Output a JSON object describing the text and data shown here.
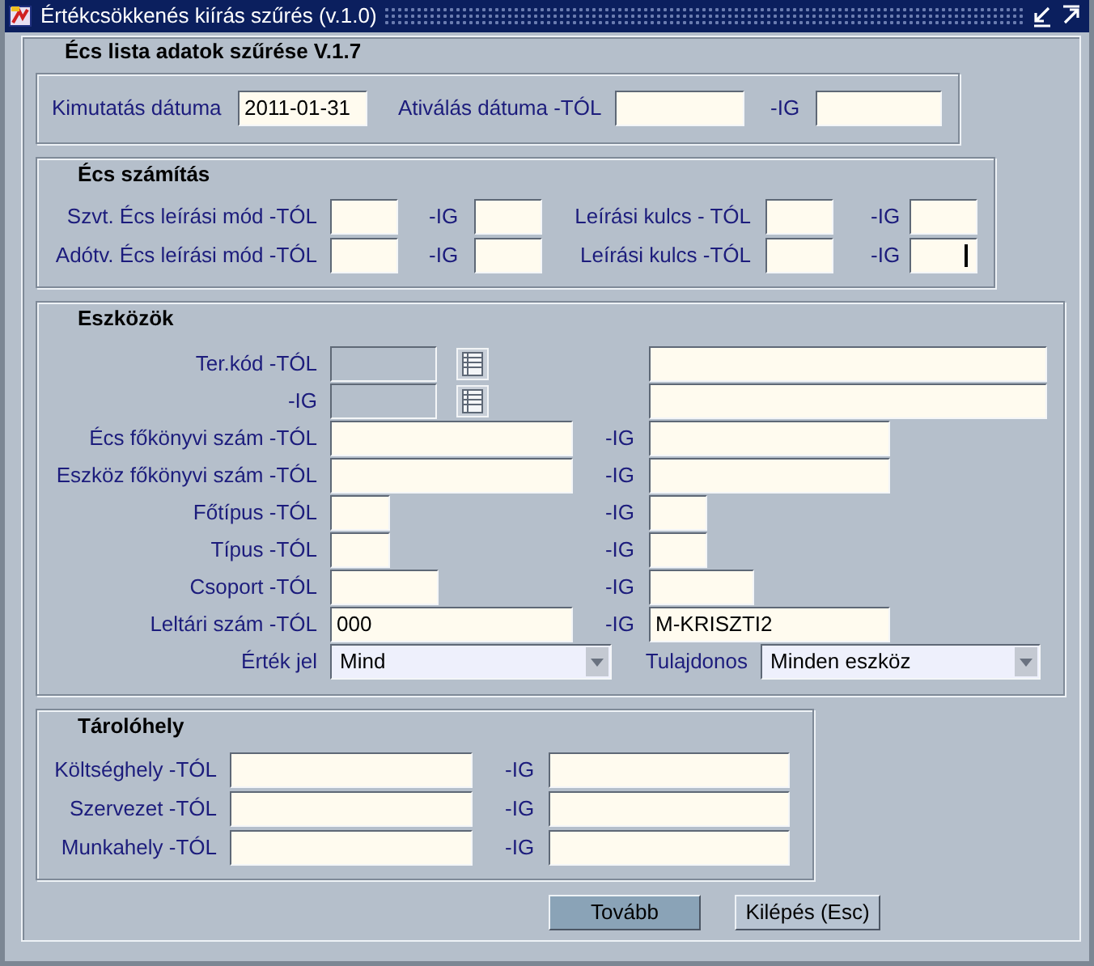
{
  "window": {
    "title": "Értékcsökkenés kiírás szűrés (v.1.0)"
  },
  "form_title": "Écs lista adatok szűrése V.1.7",
  "report": {
    "date_label": "Kimutatás dátuma",
    "date_value": "2011-01-31",
    "activation_from_label": "Ativálás dátuma -TÓL",
    "activation_to_label": "-IG"
  },
  "calculation": {
    "title": "Écs számítás",
    "rows": [
      {
        "label": "Szvt. Écs leírási mód -TÓL",
        "to_label": "-IG",
        "key_label": "Leírási kulcs - TÓL",
        "key_to_label": "-IG",
        "focused": false
      },
      {
        "label": "Adótv. Écs leírási mód -TÓL",
        "to_label": "-IG",
        "key_label": "Leírási kulcs -TÓL",
        "key_to_label": "-IG",
        "focused": true
      }
    ]
  },
  "assets": {
    "title": "Eszközök",
    "rows": [
      {
        "kind": "lookup",
        "label": "Ter.kód -TÓL",
        "disabled": true
      },
      {
        "kind": "lookup",
        "label": "-IG",
        "disabled": true
      },
      {
        "kind": "range",
        "label": "Écs főkönyvi szám -TÓL",
        "to_label": "-IG"
      },
      {
        "kind": "range",
        "label": "Eszköz főkönyvi szám -TÓL",
        "to_label": "-IG"
      },
      {
        "kind": "range",
        "label": "Főtípus -TÓL",
        "to_label": "-IG"
      },
      {
        "kind": "range",
        "label": "Típus -TÓL",
        "to_label": "-IG"
      },
      {
        "kind": "range",
        "label": "Csoport -TÓL",
        "to_label": "-IG"
      },
      {
        "kind": "range",
        "label": "Leltári szám -TÓL",
        "to_label": "-IG",
        "from_value": "000",
        "to_value": "M-KRISZTI2"
      },
      {
        "kind": "selects",
        "label": "Érték jel",
        "value": "Mind",
        "owner_label": "Tulajdonos",
        "owner_value": "Minden eszköz"
      }
    ]
  },
  "storage": {
    "title": "Tárolóhely",
    "rows": [
      {
        "label": "Költséghely -TÓL",
        "to_label": "-IG"
      },
      {
        "label": "Szervezet -TÓL",
        "to_label": "-IG"
      },
      {
        "label": "Munkahely -TÓL",
        "to_label": "-IG"
      }
    ]
  },
  "buttons": [
    {
      "label": "Tovább",
      "focused": true
    },
    {
      "label": "Kilépés (Esc)",
      "focused": false
    }
  ]
}
